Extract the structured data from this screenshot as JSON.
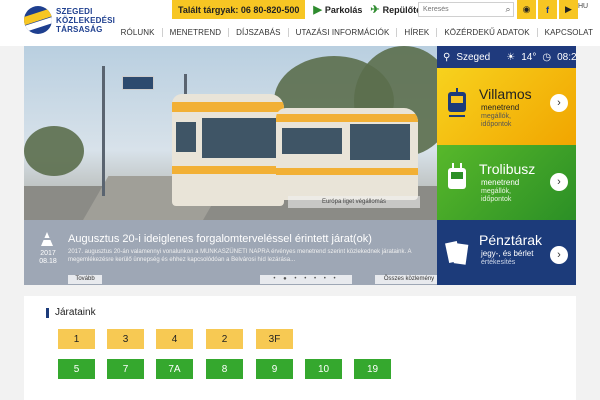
{
  "header": {
    "logo_lines": [
      "SZEGEDI",
      "KÖZLEKEDÉSI",
      "TÁRSASÁG"
    ],
    "hotline_label": "Talált tárgyak: 06 80-820-500",
    "quick_links": [
      {
        "label": "Parkolás",
        "icon": "parking-icon"
      },
      {
        "label": "Repülőtér",
        "icon": "airplane-icon"
      }
    ],
    "search_placeholder": "Keresés",
    "facebook_glyph": "f",
    "language": "HU"
  },
  "nav": {
    "items": [
      "RÓLUNK",
      "MENETREND",
      "DÍJSZABÁS",
      "UTAZÁSI INFORMÁCIÓK",
      "HÍREK",
      "KÖZÉRDEKŰ ADATOK",
      "KAPCSOLAT"
    ]
  },
  "hero": {
    "caption": "Európa liget végállomás"
  },
  "news": {
    "date_year": "2017",
    "date_day": "08.18",
    "title": "Augusztus 20-i ideiglenes forgalomterveléssel érintett járat(ok)",
    "text": "2017. augusztus 20-án valamennyi vonalunkon a MUNKASZÜNETI NAPRA érvényes menetrend szerint közlekednek járataink. A megemlékezésre kerülő ünnepség és ehhez kapcsolódóan a Belvárosi híd lezárása...",
    "more_label": "Tovább",
    "pager": "• ● • • • • •",
    "all_label": "Összes közlemény"
  },
  "weather": {
    "city": "Szeged",
    "temperature": "14°",
    "time": "08:26"
  },
  "panels": {
    "villamos": {
      "title": "Villamos",
      "subtitle": "menetrend",
      "detail1": "megállók,",
      "detail2": "időpontok"
    },
    "trolibusz": {
      "title": "Trolibusz",
      "subtitle": "menetrend",
      "detail1": "megállók,",
      "detail2": "időpontok"
    },
    "penztarak": {
      "title": "Pénztárak",
      "subtitle": "jegy-, és bérlet",
      "detail1": "értékesítés"
    }
  },
  "lines": {
    "title": "Járataink",
    "tram_lines": [
      "1",
      "3",
      "4",
      "2",
      "3F"
    ],
    "trolley_lines": [
      "5",
      "7",
      "7A",
      "8",
      "9",
      "10",
      "19"
    ]
  },
  "colors": {
    "accent_yellow": "#f7c623",
    "navy": "#1c3b7a",
    "green": "#35a82e"
  }
}
